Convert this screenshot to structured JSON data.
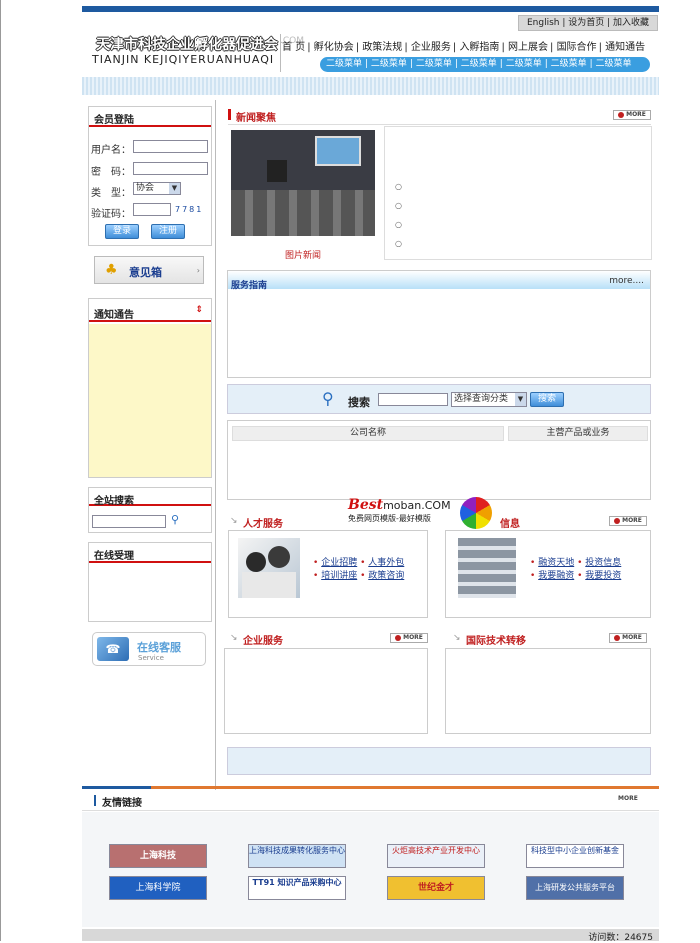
{
  "header": {
    "top_links": "English | 设为首页 | 加入收藏",
    "logo_cn": "天津市科技企业孵化器促进会",
    "logo_suffix": ".COM",
    "logo_en": "TIANJIN KEJIQIYERUANHUAQI",
    "nav": [
      "首 页",
      "孵化协会",
      "政策法规",
      "企业服务",
      "入孵指南",
      "网上展会",
      "国际合作",
      "通知通告"
    ],
    "subnav": [
      "二级菜单",
      "二级菜单",
      "二级菜单",
      "二级菜单",
      "二级菜单",
      "二级菜单",
      "二级菜单"
    ]
  },
  "login": {
    "title": "会员登陆",
    "username_label": "用户名：",
    "password_label": "密　码：",
    "type_label": "类　型：",
    "type_value": "协会",
    "captcha_label": "验证码：",
    "captcha_code": "7781",
    "login_btn": "登录",
    "register_btn": "注册"
  },
  "suggestion_box": "意见箱",
  "notices": {
    "title": "通知通告"
  },
  "site_search": {
    "title": "全站搜索"
  },
  "online_accept": {
    "title": "在线受理"
  },
  "online_service": {
    "title": "在线客服",
    "sub": "Service"
  },
  "news": {
    "title": "新闻聚焦",
    "more": "MORE",
    "photo_caption": "图片新闻"
  },
  "service_guide": {
    "title": "服务指南",
    "more": "more...."
  },
  "search": {
    "label": "搜索",
    "select_value": "选择查询分类",
    "button": "搜索",
    "col_company": "公司名称",
    "col_product": "主营产品或业务"
  },
  "watermark": {
    "brand1": "Best",
    "brand2": "moban.COM",
    "sub": "免费网页模版-最好模版"
  },
  "talent": {
    "title": "人才服务",
    "more": "MORE",
    "links": [
      "企业招聘",
      "人事外包",
      "培训讲座",
      "政策咨询"
    ]
  },
  "finance": {
    "title": "信息",
    "more": "MORE",
    "links": [
      "融资天地",
      "投资信息",
      "我要融资",
      "我要投资"
    ]
  },
  "enterprise": {
    "title": "企业服务",
    "more": "MORE"
  },
  "intl": {
    "title": "国际技术转移",
    "more": "MORE"
  },
  "links": {
    "title": "友情链接",
    "more": "MORE",
    "logos": [
      "上海科技",
      "上海科技成果转化服务中心",
      "火炬高技术产业开发中心",
      "科技型中小企业创新基金",
      "上海科学院",
      "TT91 知识产品采购中心",
      "世纪金才",
      "上海研发公共服务平台"
    ]
  },
  "footer": {
    "visits": "访问数：24675"
  },
  "colors": {
    "blue": "#1e5aa0",
    "red": "#d01010",
    "lightblue": "#3a9ee0",
    "notice_bg": "#fdf8c8"
  }
}
